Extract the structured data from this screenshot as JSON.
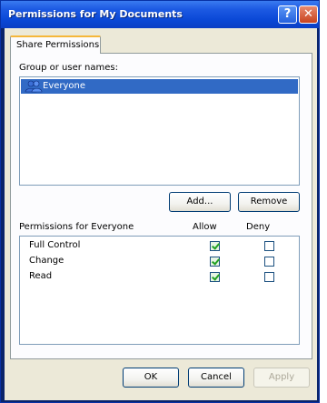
{
  "window": {
    "title": "Permissions for My Documents",
    "help_glyph": "?",
    "close_glyph": "✕"
  },
  "tab": {
    "label": "Share Permissions"
  },
  "users": {
    "label": "Group or user names:",
    "items": [
      {
        "name": "Everyone",
        "icon": "users-icon",
        "selected": true
      }
    ]
  },
  "buttons": {
    "add": "Add...",
    "remove": "Remove",
    "ok": "OK",
    "cancel": "Cancel",
    "apply": "Apply"
  },
  "permissions": {
    "label": "Permissions for Everyone",
    "columns": {
      "allow": "Allow",
      "deny": "Deny"
    },
    "rows": [
      {
        "name": "Full Control",
        "allow": true,
        "deny": false
      },
      {
        "name": "Change",
        "allow": true,
        "deny": false
      },
      {
        "name": "Read",
        "allow": true,
        "deny": false
      }
    ]
  }
}
